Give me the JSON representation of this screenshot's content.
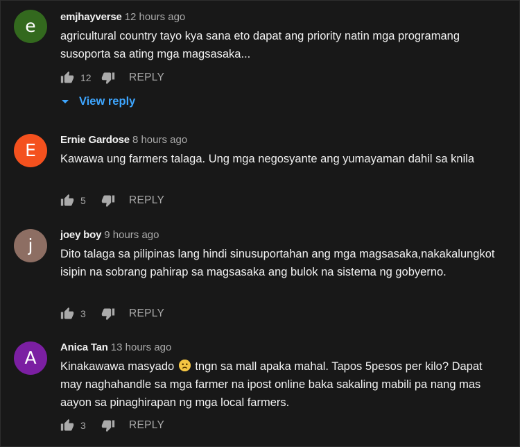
{
  "comments": [
    {
      "author": "emjhayverse",
      "time": "12 hours ago",
      "avatar_letter": "e",
      "avatar_color": "#33691e",
      "text": "agricultural country tayo kya sana  eto dapat ang priority  natin mga programang susoporta sa ating mga magsasaka...",
      "likes": "12",
      "reply_label": "REPLY",
      "view_reply_label": "View reply"
    },
    {
      "author": "Ernie Gardose",
      "time": "8 hours ago",
      "avatar_letter": "E",
      "avatar_color": "#f4511e",
      "text": "Kawawa ung farmers talaga. Ung mga negosyante ang yumayaman dahil sa knila",
      "likes": "5",
      "reply_label": "REPLY"
    },
    {
      "author": "joey boy",
      "time": "9 hours ago",
      "avatar_letter": "j",
      "avatar_color": "#8d6e63",
      "text": "Dito talaga sa pilipinas lang hindi sinusuportahan ang mga magsasaka,nakakalungkot isipin na sobrang pahirap sa magsasaka ang bulok na sistema ng gobyerno.",
      "likes": "3",
      "reply_label": "REPLY"
    },
    {
      "author": "Anica Tan",
      "time": "13 hours ago",
      "avatar_letter": "A",
      "avatar_color": "#7b1fa2",
      "text_before_emoji": "Kinakawawa masyado ",
      "text_emoji": "sad-face-emoji",
      "text_after_emoji": " tngn sa mall apaka mahal. Tapos 5pesos per kilo? Dapat may naghahandle sa mga farmer na ipost online baka sakaling mabili pa nang mas aayon sa pinaghirapan ng mga local farmers.",
      "likes": "3",
      "reply_label": "REPLY"
    }
  ],
  "icons": {
    "like": "thumbs-up-icon",
    "dislike": "thumbs-down-icon",
    "view_reply": "caret-down-icon"
  },
  "colors": {
    "background": "#181818",
    "text": "#f1f1f1",
    "secondary": "#aaaaaa",
    "link": "#3ea6ff"
  }
}
